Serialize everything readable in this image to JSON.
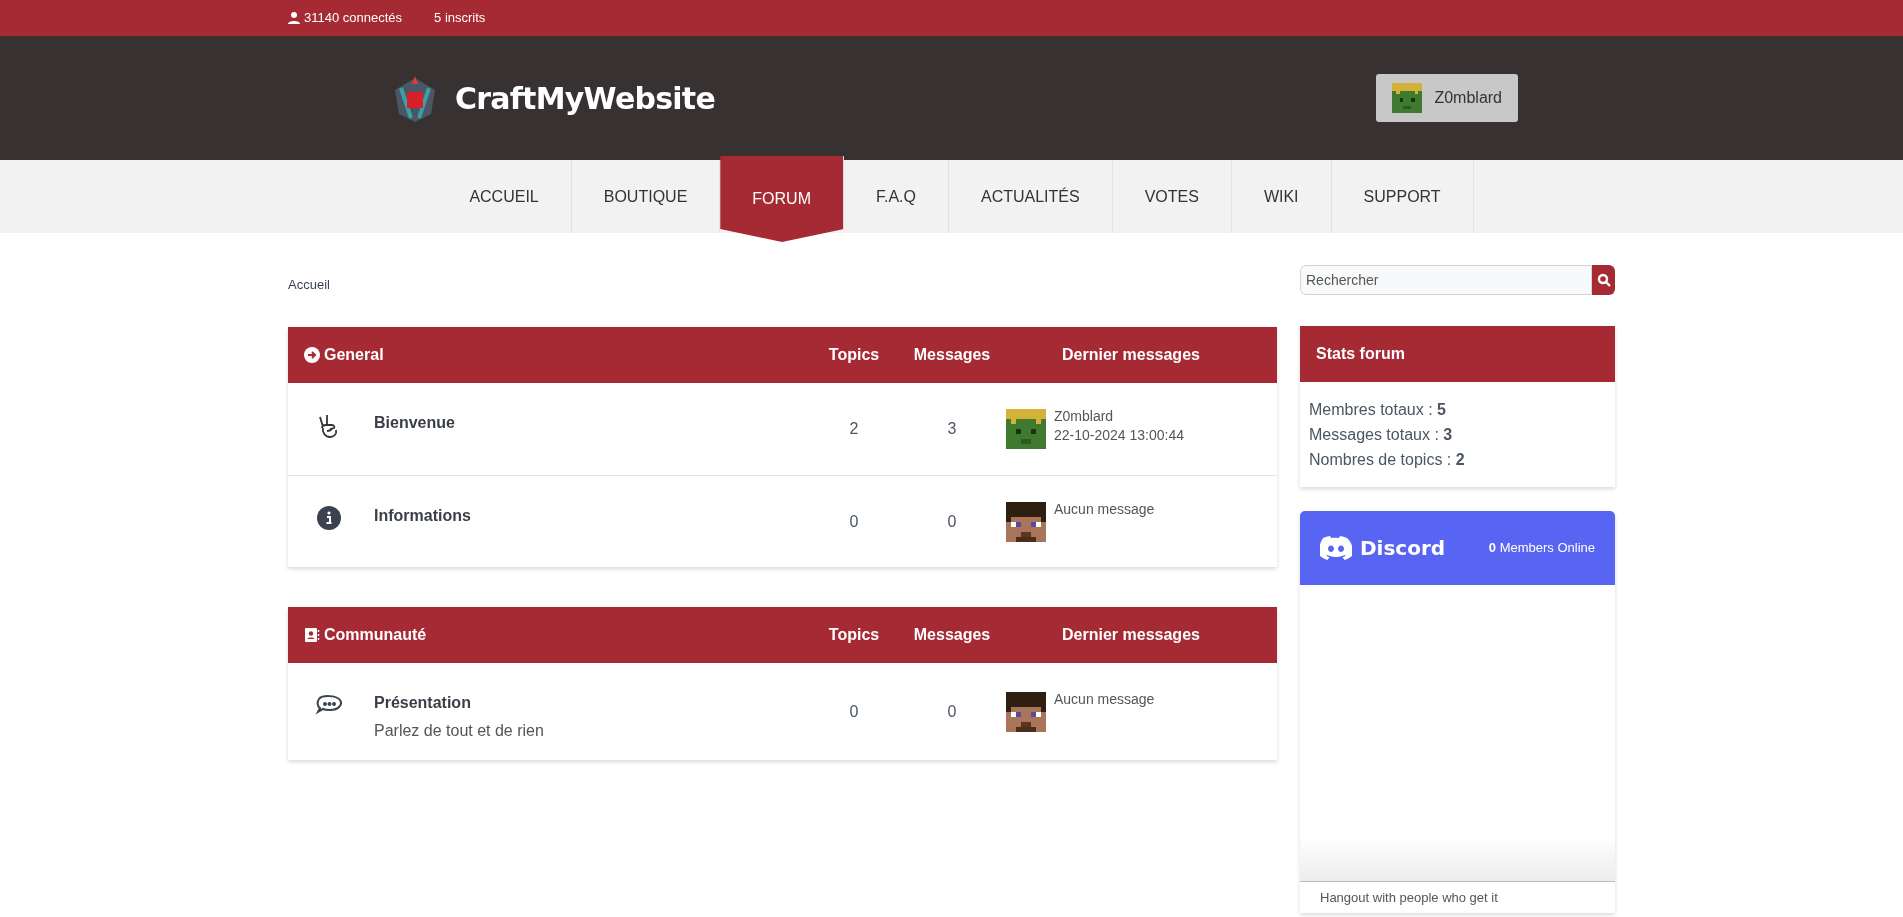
{
  "topbar": {
    "online": "31140 connectés",
    "registered": "5 inscrits"
  },
  "header": {
    "site_name": "CraftMyWebsite",
    "user_button": "Z0mblard"
  },
  "nav": [
    {
      "label": "ACCUEIL",
      "selected": false
    },
    {
      "label": "BOUTIQUE",
      "selected": false
    },
    {
      "label": "FORUM",
      "selected": true
    },
    {
      "label": "F.A.Q",
      "selected": false
    },
    {
      "label": "ACTUALITÉS",
      "selected": false
    },
    {
      "label": "VOTES",
      "selected": false
    },
    {
      "label": "WIKI",
      "selected": false
    },
    {
      "label": "SUPPORT",
      "selected": false
    }
  ],
  "breadcrumb": "Accueil",
  "categories": [
    {
      "title": "General",
      "kind": "arrow",
      "columns": [
        "Topics",
        "Messages",
        "Dernier messages"
      ],
      "forums": [
        {
          "name": "Bienvenue",
          "kind": "hand",
          "topics": "2",
          "messages": "3",
          "last": {
            "author": "Z0mblard",
            "date": "22-10-2024 13:00:44"
          }
        },
        {
          "name": "Informations",
          "kind": "info",
          "topics": "0",
          "messages": "0",
          "last": {
            "text": "Aucun message"
          }
        }
      ]
    },
    {
      "title": "Communauté",
      "kind": "contact",
      "columns": [
        "Topics",
        "Messages",
        "Dernier messages"
      ],
      "forums": [
        {
          "name": "Présentation",
          "description": "Parlez de tout et de rien",
          "kind": "chat",
          "topics": "0",
          "messages": "0",
          "last": {
            "text": "Aucun message"
          }
        }
      ]
    }
  ],
  "search": {
    "placeholder": "Rechercher"
  },
  "stats": {
    "title": "Stats forum",
    "lines": [
      "Membres totaux : **5**",
      "Messages totaux : **3**",
      "Nombres de topics : **2**"
    ]
  },
  "discord": {
    "title": "Discord",
    "online": "**0** Members Online",
    "footer": "Hangout with people who get it"
  }
}
